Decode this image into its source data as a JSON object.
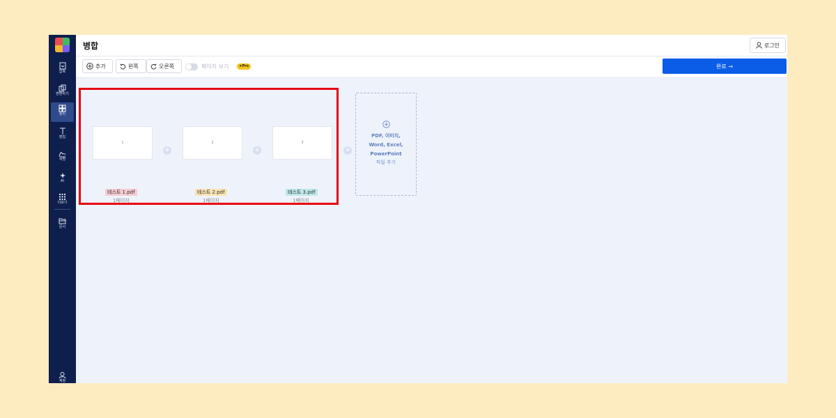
{
  "header": {
    "title": "병합",
    "login_label": "로그인"
  },
  "sidebar": {
    "items": [
      {
        "label": "압축"
      },
      {
        "label": "변환하기"
      },
      {
        "label": "정리"
      },
      {
        "label": "편집"
      },
      {
        "label": "서명"
      },
      {
        "label": "AI"
      },
      {
        "label": "더보기"
      },
      {
        "label": "문서"
      },
      {
        "label": "계정"
      }
    ]
  },
  "toolbar": {
    "add_label": "추가",
    "left_label": "왼쪽",
    "right_label": "오른쪽",
    "page_view_label": "페이지 보기",
    "pro_label": "★Pro",
    "done_label": "완료 →"
  },
  "files": [
    {
      "page_number": "1",
      "name": "테스트 1.pdf",
      "pages": "1페이지",
      "tag_color": "#f6cbd2"
    },
    {
      "page_number": "2",
      "name": "테스트 2.pdf",
      "pages": "1페이지",
      "tag_color": "#f9e2b4"
    },
    {
      "page_number": "3",
      "name": "테스트 3.pdf",
      "pages": "1페이지",
      "tag_color": "#bfe7ea"
    }
  ],
  "add_files": {
    "line1": "PDF, 이미지,",
    "line2": "Word, Excel,",
    "line3": "PowerPoint",
    "line4": "파일 추가"
  },
  "colors": {
    "accent": "#0b5ce6",
    "sidebar_bg": "#0e1f4d",
    "highlight": "#e60012",
    "page_bg": "#fdecc0"
  }
}
